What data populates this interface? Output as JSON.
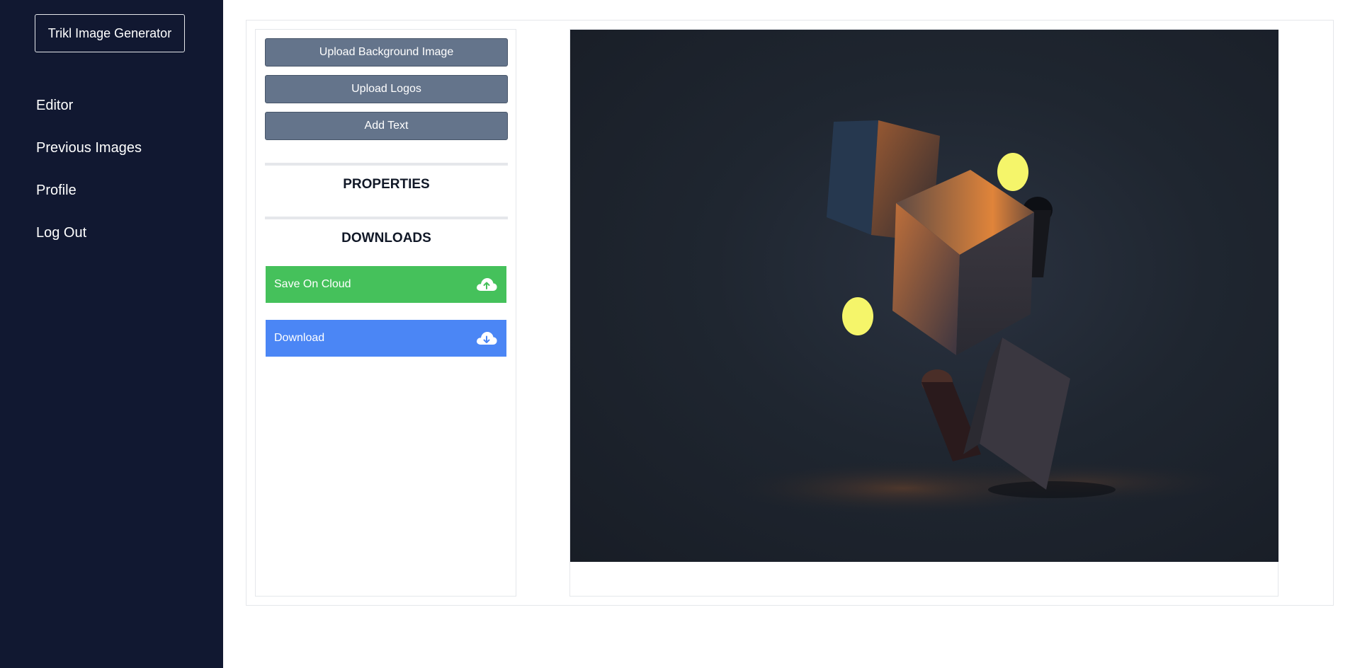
{
  "sidebar": {
    "brand": "Trikl Image Generator",
    "items": [
      {
        "label": "Editor"
      },
      {
        "label": "Previous Images"
      },
      {
        "label": "Profile"
      },
      {
        "label": "Log Out"
      }
    ]
  },
  "tools": {
    "upload_background_label": "Upload Background Image",
    "upload_logos_label": "Upload Logos",
    "add_text_label": "Add Text",
    "properties_title": "PROPERTIES",
    "downloads_title": "DOWNLOADS",
    "save_cloud_label": "Save On Cloud",
    "download_label": "Download"
  },
  "icons": {
    "save_cloud": "cloud-upload-icon",
    "download": "cloud-download-icon"
  },
  "colors": {
    "sidebar_bg": "#111831",
    "tool_button": "#64748b",
    "save_cloud": "#45c15b",
    "download": "#4b86f5",
    "circle_yellow": "#f5f56a"
  }
}
